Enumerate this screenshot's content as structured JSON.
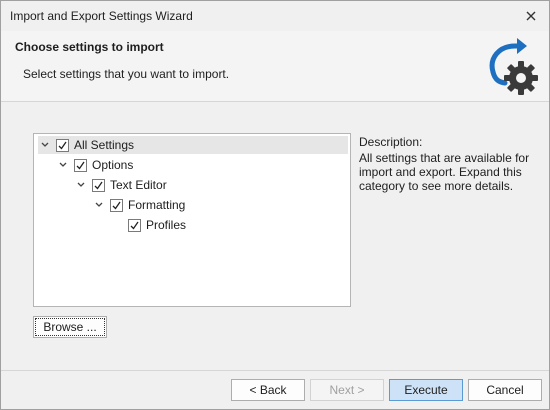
{
  "window": {
    "title": "Import and Export Settings Wizard"
  },
  "header": {
    "title": "Choose settings to import",
    "subtitle": "Select settings that you want to import.",
    "icon": "import-settings-gear-icon",
    "accent_color": "#1e6fc0",
    "gear_color": "#3a3a3a"
  },
  "tree": {
    "items": [
      {
        "label": "All Settings",
        "checked": true,
        "expanded": true,
        "selected": true
      },
      {
        "label": "Options",
        "checked": true,
        "expanded": true
      },
      {
        "label": "Text Editor",
        "checked": true,
        "expanded": true
      },
      {
        "label": "Formatting",
        "checked": true,
        "expanded": true
      },
      {
        "label": "Profiles",
        "checked": true
      }
    ]
  },
  "description": {
    "title": "Description:",
    "body": "All settings that are available for import and export. Expand this category to see more details."
  },
  "buttons": {
    "browse": "Browse ...",
    "back": "< Back",
    "next": "Next >",
    "execute": "Execute",
    "cancel": "Cancel"
  }
}
